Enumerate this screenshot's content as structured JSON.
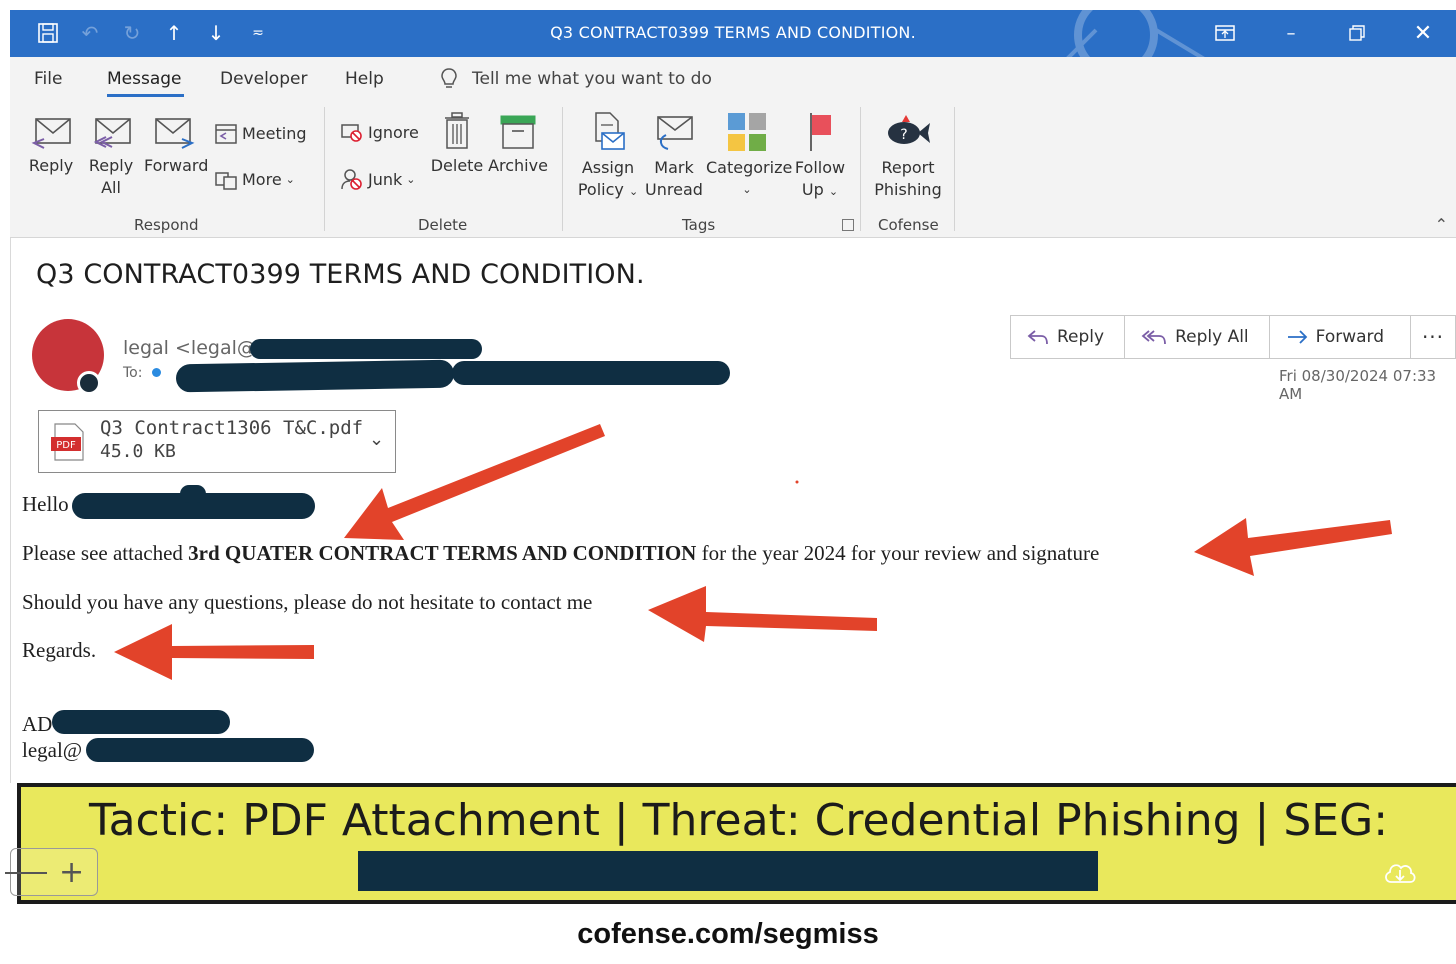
{
  "window": {
    "title": "Q3 CONTRACT0399 TERMS AND CONDITION."
  },
  "menu": {
    "items": [
      "File",
      "Message",
      "Developer",
      "Help"
    ],
    "active": "Message",
    "tell_me": "Tell me what you want to do"
  },
  "ribbon": {
    "respond": {
      "reply": "Reply",
      "reply_all_1": "Reply",
      "reply_all_2": "All",
      "forward": "Forward",
      "meeting": "Meeting",
      "more": "More",
      "group": "Respond"
    },
    "delete": {
      "ignore": "Ignore",
      "junk": "Junk",
      "delete": "Delete",
      "archive": "Archive",
      "group": "Delete"
    },
    "tags": {
      "assign_1": "Assign",
      "assign_2": "Policy",
      "mark_1": "Mark",
      "mark_2": "Unread",
      "categorize": "Categorize",
      "follow_1": "Follow",
      "follow_2": "Up",
      "group": "Tags"
    },
    "cofense": {
      "report_1": "Report",
      "report_2": "Phishing",
      "group": "Cofense"
    }
  },
  "message": {
    "subject": "Q3 CONTRACT0399 TERMS AND CONDITION.",
    "sender_prefix": "legal <legal@e",
    "to_label": "To:",
    "actions": {
      "reply": "Reply",
      "reply_all": "Reply All",
      "forward": "Forward",
      "more": "···"
    },
    "datetime": "Fri 08/30/2024 07:33 AM",
    "attachment": {
      "name": "Q3 Contract1306 T&C.pdf",
      "size": "45.0 KB",
      "badge": "PDF"
    },
    "body": {
      "greeting": "Hello",
      "line1_pre": "Please see attached ",
      "line1_bold": "3rd QUATER CONTRACT TERMS AND CONDITION",
      "line1_post": " for the year 2024 for your review and signature",
      "line2": "Should you have any questions, please do not hesitate to contact me",
      "closing": "Regards.",
      "sig1": "AD",
      "sig2": "legal@"
    }
  },
  "banner": {
    "text": "Tactic: PDF Attachment | Threat: Credential Phishing | SEG:"
  },
  "footer": {
    "url": "cofense.com/segmiss"
  },
  "colors": {
    "titlebar": "#2b6fc6",
    "banner": "#e9e85c",
    "redaction": "#0f2e42",
    "arrow": "#e2432a",
    "avatar": "#c7343a"
  }
}
